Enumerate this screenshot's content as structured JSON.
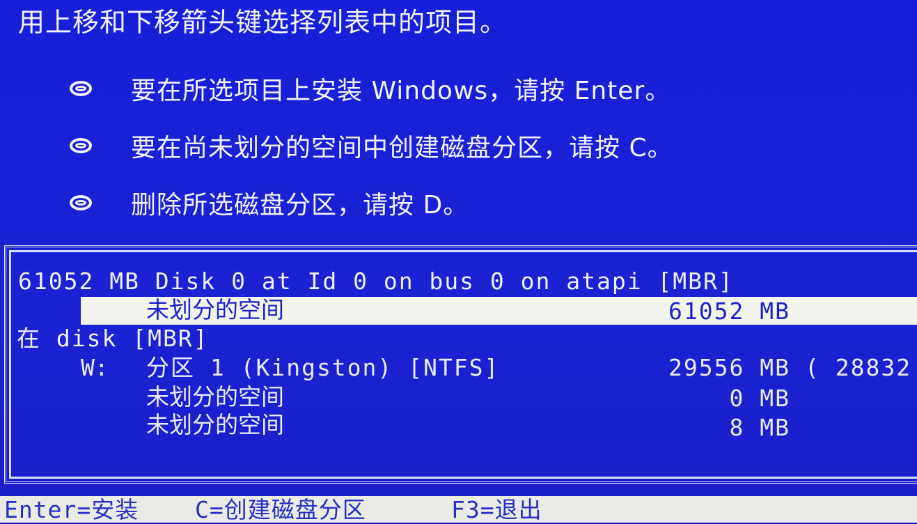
{
  "instruction": "用上移和下移箭头键选择列表中的项目。",
  "options": [
    {
      "icon": "bullet-icon",
      "text": "要在所选项目上安装 Windows，请按 Enter。"
    },
    {
      "icon": "bullet-icon",
      "text": "要在尚未划分的空间中创建磁盘分区，请按 C。"
    },
    {
      "icon": "bullet-icon",
      "text": "删除所选磁盘分区，请按 D。"
    }
  ],
  "disk_list": {
    "disk_header": "61052 MB Disk 0 at Id 0 on bus 0 on atapi [MBR]",
    "selected_item": {
      "name": "未划分的空间",
      "size": "61052 MB"
    },
    "disk2_label": "在 disk [MBR]",
    "partitions": [
      {
        "drive": "W:",
        "name": "分区 1 (Kingston) [NTFS]",
        "size": "29556 MB",
        "extra": "( 28832"
      },
      {
        "drive": "",
        "name": "未划分的空间",
        "size": "0 MB",
        "extra": ""
      },
      {
        "drive": "",
        "name": "未划分的空间",
        "size": "8 MB",
        "extra": ""
      }
    ]
  },
  "statusbar": {
    "items": [
      "Enter=安装",
      "C=创建磁盘分区",
      "F3=退出"
    ]
  },
  "colors": {
    "background": "#1a1fd6",
    "text": "#eef0ff",
    "highlight_bg": "#f4f4ee",
    "highlight_text": "#1b22c8",
    "statusbar_bg": "#ebebe6"
  }
}
